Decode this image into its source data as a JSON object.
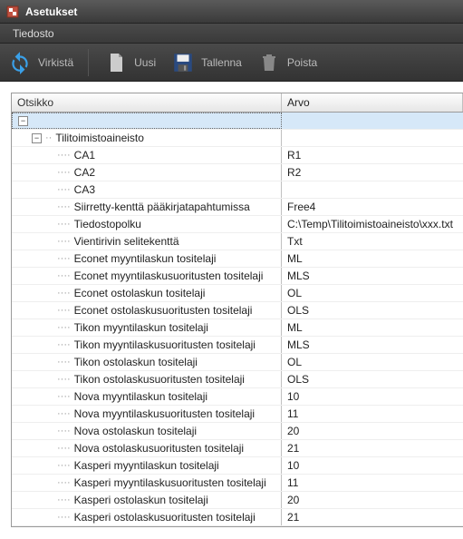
{
  "window": {
    "title": "Asetukset"
  },
  "menu": {
    "file": "Tiedosto"
  },
  "toolbar": {
    "refresh": "Virkistä",
    "new": "Uusi",
    "save": "Tallenna",
    "delete": "Poista"
  },
  "grid": {
    "columns": {
      "name": "Otsikko",
      "value": "Arvo"
    },
    "root": {
      "expanded": true,
      "label": ""
    },
    "group": {
      "label": "Tilitoimistoaineisto",
      "expanded": true
    },
    "rows": [
      {
        "name": "CA1",
        "value": "R1"
      },
      {
        "name": "CA2",
        "value": "R2"
      },
      {
        "name": "CA3",
        "value": ""
      },
      {
        "name": "Siirretty-kenttä pääkirjatapahtumissa",
        "value": "Free4"
      },
      {
        "name": "Tiedostopolku",
        "value": "C:\\Temp\\Tilitoimistoaineisto\\xxx.txt"
      },
      {
        "name": "Vientirivin selitekenttä",
        "value": "Txt"
      },
      {
        "name": "Econet myyntilaskun tositelaji",
        "value": "ML"
      },
      {
        "name": "Econet myyntilaskusuoritusten tositelaji",
        "value": "MLS"
      },
      {
        "name": "Econet ostolaskun tositelaji",
        "value": "OL"
      },
      {
        "name": "Econet ostolaskusuoritusten tositelaji",
        "value": "OLS"
      },
      {
        "name": "Tikon myyntilaskun tositelaji",
        "value": "ML"
      },
      {
        "name": "Tikon myyntilaskusuoritusten tositelaji",
        "value": "MLS"
      },
      {
        "name": "Tikon ostolaskun tositelaji",
        "value": "OL"
      },
      {
        "name": "Tikon ostolaskusuoritusten tositelaji",
        "value": "OLS"
      },
      {
        "name": "Nova myyntilaskun tositelaji",
        "value": "10"
      },
      {
        "name": "Nova myyntilaskusuoritusten tositelaji",
        "value": "11"
      },
      {
        "name": "Nova ostolaskun tositelaji",
        "value": "20"
      },
      {
        "name": "Nova ostolaskusuoritusten tositelaji",
        "value": "21"
      },
      {
        "name": "Kasperi myyntilaskun tositelaji",
        "value": "10"
      },
      {
        "name": "Kasperi myyntilaskusuoritusten tositelaji",
        "value": "11"
      },
      {
        "name": "Kasperi ostolaskun tositelaji",
        "value": "20"
      },
      {
        "name": "Kasperi ostolaskusuoritusten tositelaji",
        "value": "21"
      }
    ]
  }
}
